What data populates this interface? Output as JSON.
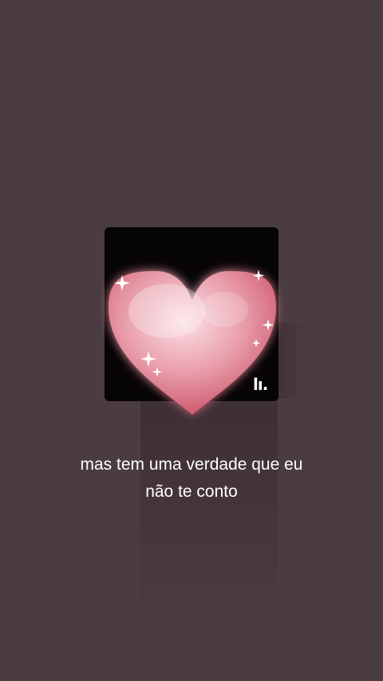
{
  "app": {
    "background_color": "#4b3c42"
  },
  "artwork": {
    "icon": "heart-icon",
    "background_color": "#070406",
    "heart_color_top": "#f6c7d0",
    "heart_color_bottom": "#c6455a",
    "brand_mark_text": "lı."
  },
  "lyrics": {
    "line1": "mas tem uma verdade que eu",
    "line2": "não te conto"
  }
}
